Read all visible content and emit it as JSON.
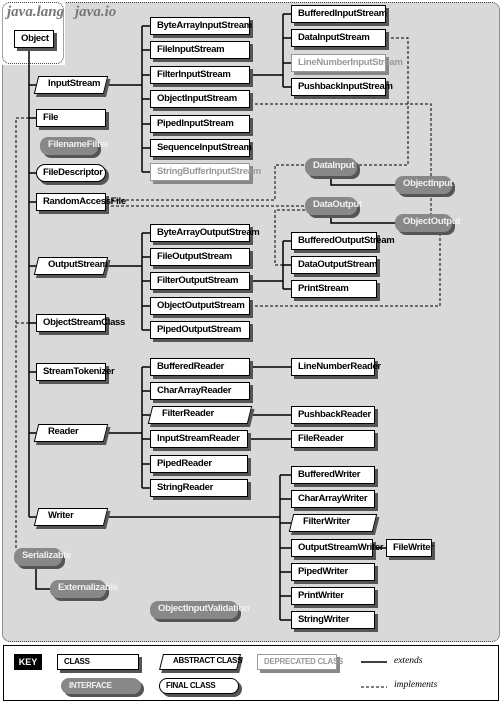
{
  "packages": {
    "lang": "java.lang",
    "io": "java.io"
  },
  "nodes": {
    "Object": {
      "label": "Object",
      "kind": "class"
    },
    "InputStream": {
      "label": "InputStream",
      "kind": "abstract"
    },
    "File": {
      "label": "File",
      "kind": "class"
    },
    "FilenameFilter": {
      "label": "FilenameFilter",
      "kind": "interface"
    },
    "FileDescriptor": {
      "label": "FileDescriptor",
      "kind": "final"
    },
    "RandomAccessFile": {
      "label": "RandomAccessFile",
      "kind": "class"
    },
    "OutputStream": {
      "label": "OutputStream",
      "kind": "abstract"
    },
    "ObjectStreamClass": {
      "label": "ObjectStreamClass",
      "kind": "class"
    },
    "StreamTokenizer": {
      "label": "StreamTokenizer",
      "kind": "class"
    },
    "Reader": {
      "label": "Reader",
      "kind": "abstract"
    },
    "Writer": {
      "label": "Writer",
      "kind": "abstract"
    },
    "Serializable": {
      "label": "Serializable",
      "kind": "interface"
    },
    "Externalizable": {
      "label": "Externalizable",
      "kind": "interface"
    },
    "ObjectInputValidation": {
      "label": "ObjectInputValidation",
      "kind": "interface"
    },
    "ByteArrayInputStream": {
      "label": "ByteArrayInputStream",
      "kind": "class"
    },
    "FileInputStream": {
      "label": "FileInputStream",
      "kind": "class"
    },
    "FilterInputStream": {
      "label": "FilterInputStream",
      "kind": "class"
    },
    "ObjectInputStream": {
      "label": "ObjectInputStream",
      "kind": "class"
    },
    "PipedInputStream": {
      "label": "PipedInputStream",
      "kind": "class"
    },
    "SequenceInputStream": {
      "label": "SequenceInputStream",
      "kind": "class"
    },
    "StringBufferInputStream": {
      "label": "StringBufferInputStream",
      "kind": "deprecated"
    },
    "BufferedInputStream": {
      "label": "BufferedInputStream",
      "kind": "class"
    },
    "DataInputStream": {
      "label": "DataInputStream",
      "kind": "class"
    },
    "LineNumberInputStream": {
      "label": "LineNumberInputStream",
      "kind": "deprecated"
    },
    "PushbackInputStream": {
      "label": "PushbackInputStream",
      "kind": "class"
    },
    "DataInput": {
      "label": "DataInput",
      "kind": "interface"
    },
    "ObjectInput": {
      "label": "ObjectInput",
      "kind": "interface"
    },
    "DataOutput": {
      "label": "DataOutput",
      "kind": "interface"
    },
    "ObjectOutput": {
      "label": "ObjectOutput",
      "kind": "interface"
    },
    "ByteArrayOutputStream": {
      "label": "ByteArrayOutputStream",
      "kind": "class"
    },
    "FileOutputStream": {
      "label": "FileOutputStream",
      "kind": "class"
    },
    "FilterOutputStream": {
      "label": "FilterOutputStream",
      "kind": "class"
    },
    "ObjectOutputStream": {
      "label": "ObjectOutputStream",
      "kind": "class"
    },
    "PipedOutputStream": {
      "label": "PipedOutputStream",
      "kind": "class"
    },
    "BufferedOutputStream": {
      "label": "BufferedOutputStream",
      "kind": "class"
    },
    "DataOutputStream": {
      "label": "DataOutputStream",
      "kind": "class"
    },
    "PrintStream": {
      "label": "PrintStream",
      "kind": "class"
    },
    "BufferedReader": {
      "label": "BufferedReader",
      "kind": "class"
    },
    "CharArrayReader": {
      "label": "CharArrayReader",
      "kind": "class"
    },
    "FilterReader": {
      "label": "FilterReader",
      "kind": "abstract"
    },
    "InputStreamReader": {
      "label": "InputStreamReader",
      "kind": "class"
    },
    "PipedReader": {
      "label": "PipedReader",
      "kind": "class"
    },
    "StringReader": {
      "label": "StringReader",
      "kind": "class"
    },
    "LineNumberReader": {
      "label": "LineNumberReader",
      "kind": "class"
    },
    "PushbackReader": {
      "label": "PushbackReader",
      "kind": "class"
    },
    "FileReader": {
      "label": "FileReader",
      "kind": "class"
    },
    "BufferedWriter": {
      "label": "BufferedWriter",
      "kind": "class"
    },
    "CharArrayWriter": {
      "label": "CharArrayWriter",
      "kind": "class"
    },
    "FilterWriter": {
      "label": "FilterWriter",
      "kind": "abstract"
    },
    "OutputStreamWriter": {
      "label": "OutputStreamWriter",
      "kind": "class"
    },
    "FileWriter": {
      "label": "FileWriter",
      "kind": "class"
    },
    "PipedWriter": {
      "label": "PipedWriter",
      "kind": "class"
    },
    "PrintWriter": {
      "label": "PrintWriter",
      "kind": "class"
    },
    "StringWriter": {
      "label": "StringWriter",
      "kind": "class"
    }
  },
  "extends": [
    [
      "InputStream",
      "Object"
    ],
    [
      "File",
      "Object"
    ],
    [
      "FileDescriptor",
      "Object"
    ],
    [
      "RandomAccessFile",
      "Object"
    ],
    [
      "OutputStream",
      "Object"
    ],
    [
      "ObjectStreamClass",
      "Object"
    ],
    [
      "StreamTokenizer",
      "Object"
    ],
    [
      "Reader",
      "Object"
    ],
    [
      "Writer",
      "Object"
    ],
    [
      "ByteArrayInputStream",
      "InputStream"
    ],
    [
      "FileInputStream",
      "InputStream"
    ],
    [
      "FilterInputStream",
      "InputStream"
    ],
    [
      "ObjectInputStream",
      "InputStream"
    ],
    [
      "PipedInputStream",
      "InputStream"
    ],
    [
      "SequenceInputStream",
      "InputStream"
    ],
    [
      "StringBufferInputStream",
      "InputStream"
    ],
    [
      "BufferedInputStream",
      "FilterInputStream"
    ],
    [
      "DataInputStream",
      "FilterInputStream"
    ],
    [
      "LineNumberInputStream",
      "FilterInputStream"
    ],
    [
      "PushbackInputStream",
      "FilterInputStream"
    ],
    [
      "ObjectInput",
      "DataInput"
    ],
    [
      "ObjectOutput",
      "DataOutput"
    ],
    [
      "Externalizable",
      "Serializable"
    ],
    [
      "ByteArrayOutputStream",
      "OutputStream"
    ],
    [
      "FileOutputStream",
      "OutputStream"
    ],
    [
      "FilterOutputStream",
      "OutputStream"
    ],
    [
      "ObjectOutputStream",
      "OutputStream"
    ],
    [
      "PipedOutputStream",
      "OutputStream"
    ],
    [
      "BufferedOutputStream",
      "FilterOutputStream"
    ],
    [
      "DataOutputStream",
      "FilterOutputStream"
    ],
    [
      "PrintStream",
      "FilterOutputStream"
    ],
    [
      "BufferedReader",
      "Reader"
    ],
    [
      "CharArrayReader",
      "Reader"
    ],
    [
      "FilterReader",
      "Reader"
    ],
    [
      "InputStreamReader",
      "Reader"
    ],
    [
      "PipedReader",
      "Reader"
    ],
    [
      "StringReader",
      "Reader"
    ],
    [
      "LineNumberReader",
      "BufferedReader"
    ],
    [
      "PushbackReader",
      "FilterReader"
    ],
    [
      "FileReader",
      "InputStreamReader"
    ],
    [
      "BufferedWriter",
      "Writer"
    ],
    [
      "CharArrayWriter",
      "Writer"
    ],
    [
      "FilterWriter",
      "Writer"
    ],
    [
      "OutputStreamWriter",
      "Writer"
    ],
    [
      "PipedWriter",
      "Writer"
    ],
    [
      "PrintWriter",
      "Writer"
    ],
    [
      "StringWriter",
      "Writer"
    ],
    [
      "FileWriter",
      "OutputStreamWriter"
    ]
  ],
  "implements": [
    [
      "File",
      "Serializable"
    ],
    [
      "ObjectStreamClass",
      "Serializable"
    ],
    [
      "DataInputStream",
      "DataInput"
    ],
    [
      "ObjectInputStream",
      "ObjectInput"
    ],
    [
      "RandomAccessFile",
      "DataInput"
    ],
    [
      "RandomAccessFile",
      "DataOutput"
    ],
    [
      "DataOutputStream",
      "DataOutput"
    ],
    [
      "ObjectOutputStream",
      "ObjectOutput"
    ]
  ],
  "key": {
    "title": "KEY",
    "class": "CLASS",
    "abstract_class": "ABSTRACT CLASS",
    "deprecated_class": "DEPRECATED CLASS",
    "interface": "INTERFACE",
    "final_class": "FINAL CLASS",
    "extends": "extends",
    "implements": "implements"
  }
}
